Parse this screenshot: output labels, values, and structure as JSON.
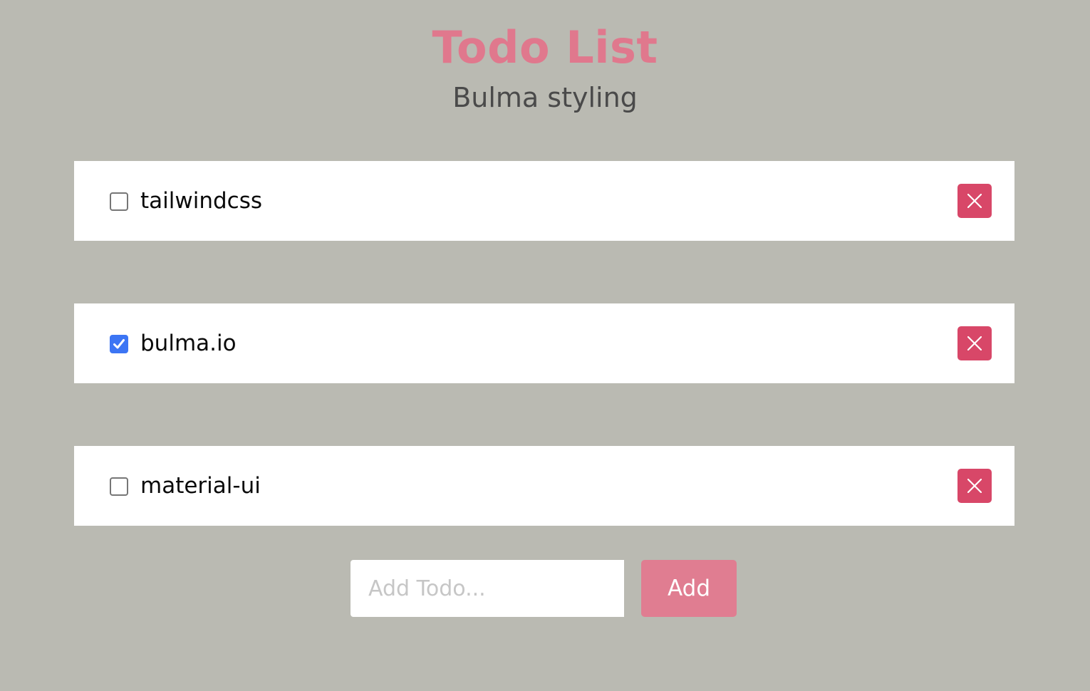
{
  "header": {
    "title": "Todo List",
    "subtitle": "Bulma styling"
  },
  "todos": [
    {
      "text": "tailwindcss",
      "checked": false
    },
    {
      "text": "bulma.io",
      "checked": true
    },
    {
      "text": "material-ui",
      "checked": false
    }
  ],
  "add_form": {
    "placeholder": "Add Todo...",
    "value": "",
    "button_label": "Add"
  },
  "colors": {
    "background": "#babab2",
    "title": "#e0788d",
    "delete": "#d84768",
    "add_button": "#e07d91",
    "checkbox_checked": "#3c75f4"
  },
  "icons": {
    "delete": "close-icon",
    "checked": "checkmark-icon"
  }
}
